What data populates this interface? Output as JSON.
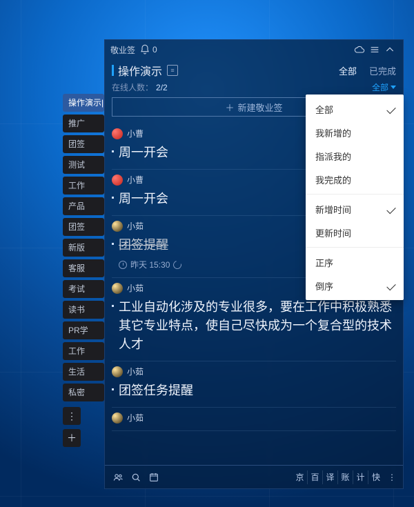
{
  "titlebar": {
    "app_name": "敬业签",
    "bell_count": "0"
  },
  "header": {
    "title": "操作演示",
    "tabs": {
      "all": "全部",
      "done": "已完成",
      "active": "all"
    }
  },
  "subrow": {
    "online_label": "在线人数：",
    "online_count": "2/2",
    "filter_label": "全部"
  },
  "new_button": "新建敬业签",
  "side_tags": [
    {
      "label": "操作演示|",
      "selected": true
    },
    {
      "label": "推广"
    },
    {
      "label": "团签"
    },
    {
      "label": "测试"
    },
    {
      "label": "工作"
    },
    {
      "label": "产品"
    },
    {
      "label": "团签"
    },
    {
      "label": "新版"
    },
    {
      "label": "客服"
    },
    {
      "label": "考试"
    },
    {
      "label": "读书"
    },
    {
      "label": "PR学"
    },
    {
      "label": "工作"
    },
    {
      "label": "生活"
    },
    {
      "label": "私密"
    }
  ],
  "items": [
    {
      "author": "小曹",
      "avatar": "red",
      "text": "周一开会"
    },
    {
      "author": "小曹",
      "avatar": "red",
      "text": "周一开会"
    },
    {
      "author": "小茹",
      "avatar": "orange",
      "text": "团签提醒",
      "strike": true,
      "time": "昨天 15:30",
      "has_clock": true,
      "has_cycle": true
    },
    {
      "author": "小茹",
      "avatar": "orange",
      "text": "工业自动化涉及的专业很多，要在工作中积极熟悉其它专业特点，使自己尽快成为一个复合型的技术人才"
    },
    {
      "author": "小茹",
      "avatar": "orange",
      "text": "团签任务提醒"
    },
    {
      "author": "小茹",
      "avatar": "orange",
      "text": ""
    }
  ],
  "footer_shortcuts": [
    "京",
    "百",
    "译",
    "账",
    "计",
    "快"
  ],
  "footer_more": "⋮",
  "dropdown": {
    "group1": [
      {
        "label": "全部",
        "checked": true
      },
      {
        "label": "我新增的"
      },
      {
        "label": "指派我的"
      },
      {
        "label": "我完成的"
      }
    ],
    "group2": [
      {
        "label": "新增时间",
        "checked": true
      },
      {
        "label": "更新时间"
      }
    ],
    "group3": [
      {
        "label": "正序"
      },
      {
        "label": "倒序",
        "checked": true
      }
    ]
  }
}
